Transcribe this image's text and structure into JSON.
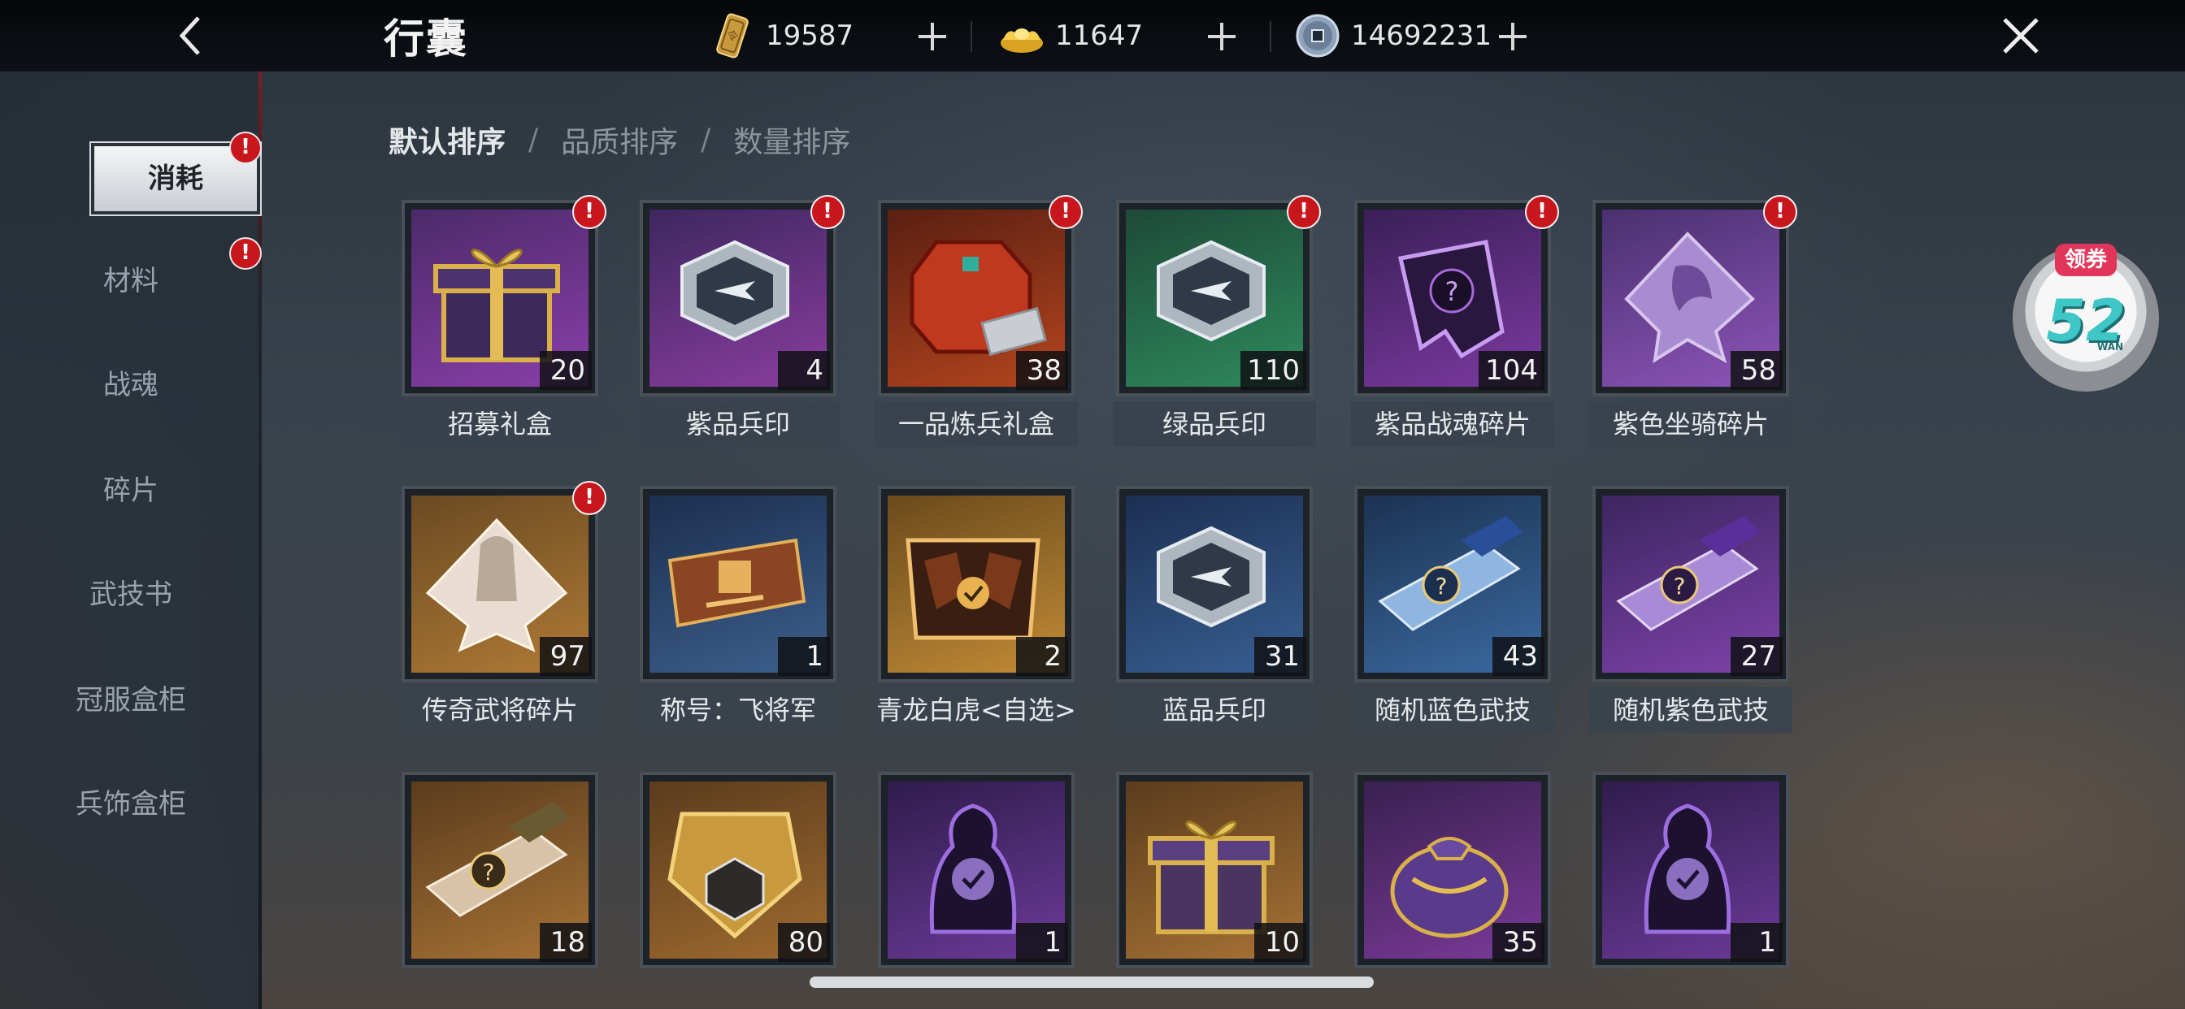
{
  "header": {
    "title": "行囊",
    "currencies": [
      {
        "icon": "token-ticket-icon",
        "value": "19587"
      },
      {
        "icon": "gold-ingot-icon",
        "value": "11647"
      },
      {
        "icon": "copper-coin-icon",
        "value": "14692231"
      }
    ]
  },
  "sidebar": {
    "items": [
      {
        "label": "消耗",
        "active": true,
        "badge": "!"
      },
      {
        "label": "材料",
        "badge": "!"
      },
      {
        "label": "战魂"
      },
      {
        "label": "碎片"
      },
      {
        "label": "武技书"
      },
      {
        "label": "冠服盒柜"
      },
      {
        "label": "兵饰盒柜"
      }
    ]
  },
  "sort": {
    "options": [
      "默认排序",
      "品质排序",
      "数量排序"
    ],
    "separator": "/",
    "active": "默认排序"
  },
  "items": [
    {
      "name": "招募礼盒",
      "count": "20",
      "badge": "!",
      "icon": "gift-box-icon"
    },
    {
      "name": "紫品兵印",
      "count": "4",
      "badge": "!",
      "icon": "seal-hex-icon"
    },
    {
      "name": "一品炼兵礼盒",
      "count": "38",
      "badge": "!",
      "icon": "forge-chest-icon"
    },
    {
      "name": "绿品兵印",
      "count": "110",
      "badge": "!",
      "icon": "seal-hex-icon"
    },
    {
      "name": "紫品战魂碎片",
      "count": "104",
      "badge": "!",
      "icon": "soul-shard-icon"
    },
    {
      "name": "紫色坐骑碎片",
      "count": "58",
      "badge": "!",
      "icon": "mount-shard-icon"
    },
    {
      "name": "传奇武将碎片",
      "count": "97",
      "badge": "!",
      "icon": "hero-shard-icon"
    },
    {
      "name": "称号：飞将军",
      "count": "1",
      "icon": "title-plaque-icon"
    },
    {
      "name": "青龙白虎<自选>",
      "count": "2",
      "icon": "dragon-tiger-chest-icon"
    },
    {
      "name": "蓝品兵印",
      "count": "31",
      "icon": "seal-hex-icon"
    },
    {
      "name": "随机蓝色武技",
      "count": "43",
      "icon": "skill-box-icon"
    },
    {
      "name": "随机紫色武技",
      "count": "27",
      "icon": "skill-box-icon"
    },
    {
      "count": "18",
      "icon": "skill-box-icon"
    },
    {
      "count": "80",
      "icon": "armor-chest-icon"
    },
    {
      "count": "1",
      "icon": "soul-select-icon"
    },
    {
      "count": "10",
      "icon": "gift-box-icon"
    },
    {
      "count": "35",
      "icon": "treasure-bag-icon"
    },
    {
      "count": "1",
      "icon": "soul-select-icon"
    }
  ],
  "coupon": {
    "tag": "领券",
    "number": "52",
    "brand": "WAN"
  }
}
